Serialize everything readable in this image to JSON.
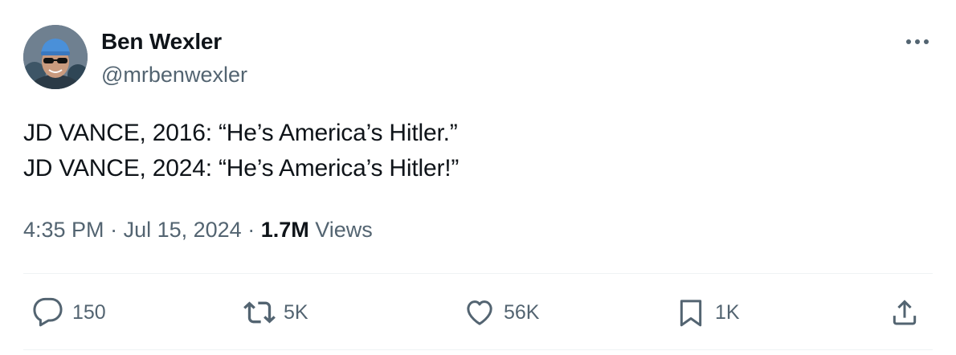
{
  "author": {
    "display_name": "Ben Wexler",
    "handle": "@mrbenwexler"
  },
  "tweet": {
    "lines": [
      "JD VANCE, 2016: “He’s America’s Hitler.”",
      "JD VANCE, 2024: “He’s America’s Hitler!”"
    ]
  },
  "meta": {
    "time": "4:35 PM",
    "sep1": " · ",
    "date": "Jul 15, 2024",
    "sep2": " · ",
    "views_count": "1.7M",
    "views_label": " Views"
  },
  "actions": {
    "replies": "150",
    "reposts": "5K",
    "likes": "56K",
    "bookmarks": "1K"
  },
  "icons": {
    "more": "more-horizontal-icon",
    "reply": "reply-icon",
    "repost": "repost-icon",
    "like": "heart-icon",
    "bookmark": "bookmark-icon",
    "share": "share-icon"
  },
  "colors": {
    "text_primary": "#0f1419",
    "text_secondary": "#536471",
    "divider": "#eff3f4"
  }
}
